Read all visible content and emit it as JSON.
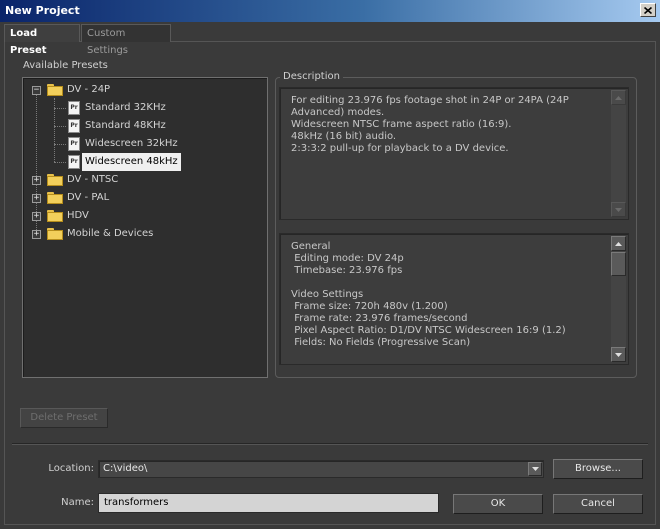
{
  "window": {
    "title": "New Project"
  },
  "tabs": [
    {
      "label": "Load Preset"
    },
    {
      "label": "Custom Settings"
    }
  ],
  "presets": {
    "heading": "Available Presets",
    "groups": [
      {
        "label": "DV - 24P",
        "expander": "−",
        "items": [
          "Standard 32KHz",
          "Standard 48KHz",
          "Widescreen 32kHz",
          "Widescreen 48kHz"
        ],
        "selected_index": 3
      },
      {
        "label": "DV - NTSC",
        "expander": "+"
      },
      {
        "label": "DV - PAL",
        "expander": "+"
      },
      {
        "label": "HDV",
        "expander": "+"
      },
      {
        "label": "Mobile & Devices",
        "expander": "+"
      }
    ],
    "file_icon_text": "Pr"
  },
  "description": {
    "heading": "Description",
    "summary": "For editing 23.976 fps footage shot in 24P or 24PA (24P\nAdvanced) modes.\nWidescreen NTSC frame aspect ratio (16:9).\n48kHz (16 bit) audio.\n2:3:3:2 pull-up for playback to a DV device.",
    "details": "General\n Editing mode: DV 24p\n Timebase: 23.976 fps\n\nVideo Settings\n Frame size: 720h 480v (1.200)\n Frame rate: 23.976 frames/second\n Pixel Aspect Ratio: D1/DV NTSC Widescreen 16:9 (1.2)\n Fields: No Fields (Progressive Scan)"
  },
  "buttons": {
    "delete_preset": "Delete Preset",
    "browse": "Browse...",
    "ok": "OK",
    "cancel": "Cancel"
  },
  "location": {
    "label": "Location:",
    "value": "C:\\video\\"
  },
  "name": {
    "label": "Name:",
    "value": "transformers"
  },
  "icons": {
    "close": "close-icon",
    "folder": "folder-icon",
    "file": "premiere-file-icon",
    "scroll_up": "arrow-up-icon",
    "scroll_down": "arrow-down-icon",
    "dropdown": "chevron-down-icon"
  }
}
